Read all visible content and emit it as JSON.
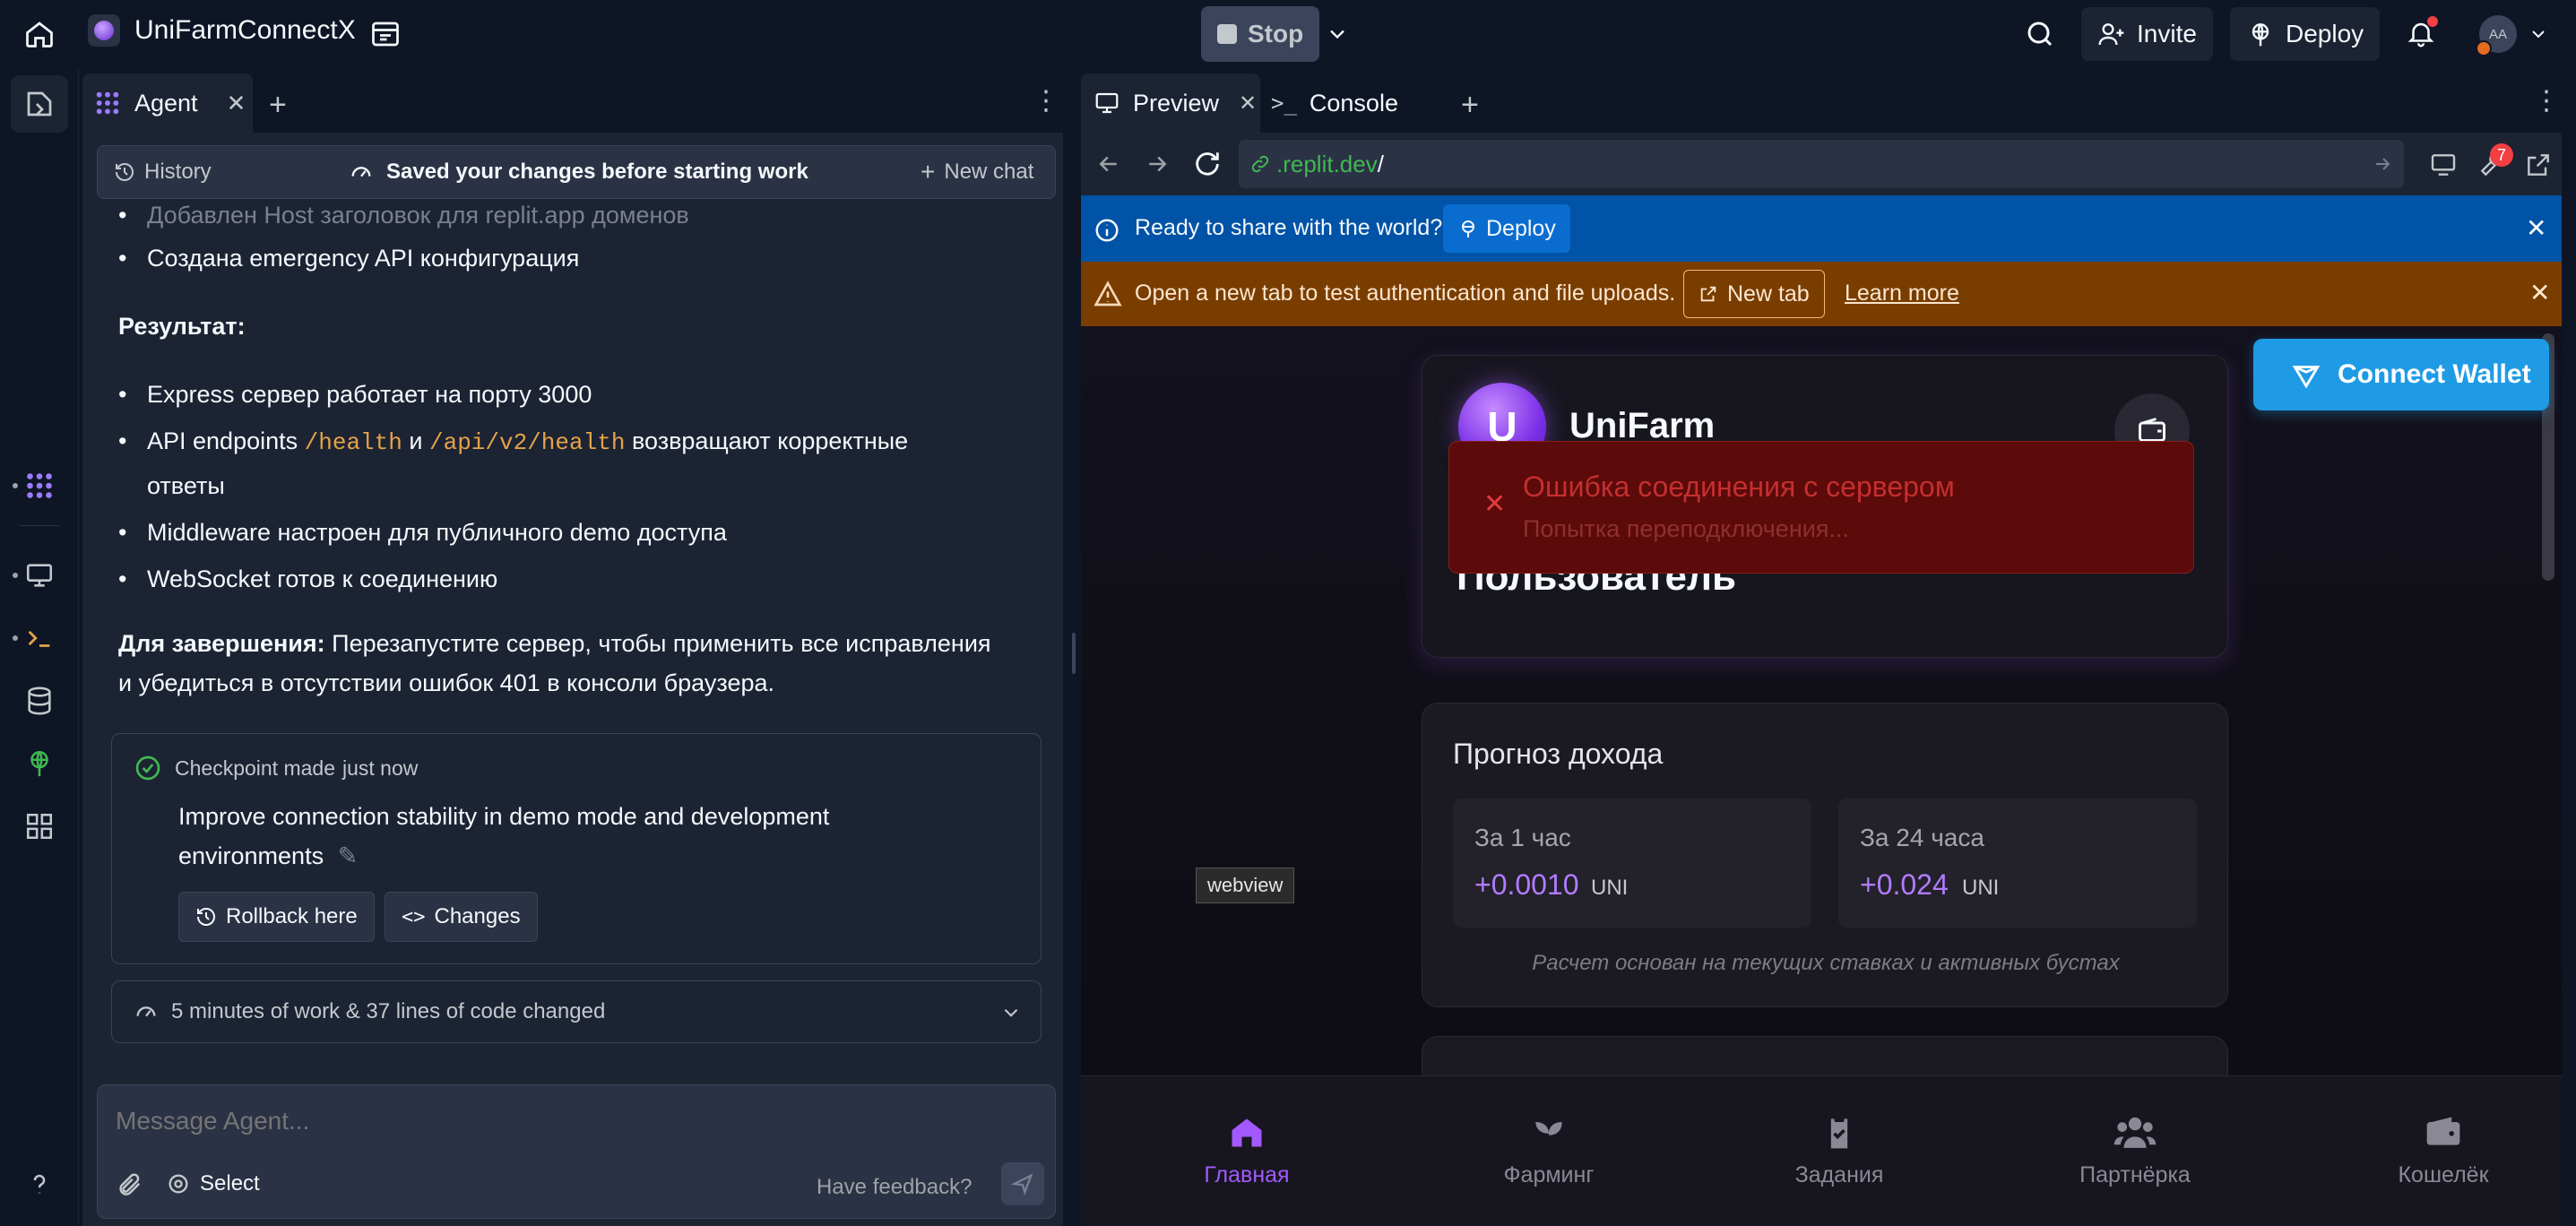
{
  "topbar": {
    "project_name": "UniFarmConnectX",
    "stop_label": "Stop",
    "invite_label": "Invite",
    "deploy_label": "Deploy",
    "avatar_initials": "AA"
  },
  "agent_tab": {
    "label": "Agent",
    "history_label": "History",
    "saved_notice": "Saved your changes before starting work",
    "new_chat_label": "New chat"
  },
  "message": {
    "faded_item": "Добавлен Host заголовок для replit.app доменов",
    "item_emergency": "Создана emergency API конфигурация",
    "result_heading": "Результат:",
    "results": [
      "Express сервер работает на порту 3000",
      "Middleware настроен для публичного demo доступа",
      "WebSocket готов к соединению"
    ],
    "api_prefix": "API endpoints",
    "api_path1": "/health",
    "api_and": "и",
    "api_path2": "/api/v2/health",
    "api_suffix_1": "возвращают корректные",
    "api_suffix_2": "ответы",
    "finish_bold": "Для завершения:",
    "finish_text_1": "Перезапустите сервер, чтобы применить все исправления",
    "finish_text_2": "и убедиться в отсутствии ошибок 401 в консоли браузера."
  },
  "checkpoint": {
    "made_label": "Checkpoint made",
    "when": "just now",
    "description_1": "Improve connection stability in demo mode and development",
    "description_2": "environments",
    "rollback_label": "Rollback here",
    "changes_label": "Changes"
  },
  "work_summary": "5 minutes of work & 37 lines of code changed",
  "composer": {
    "placeholder": "Message Agent...",
    "select_label": "Select",
    "feedback_label": "Have feedback?"
  },
  "preview_tabs": {
    "preview_label": "Preview",
    "console_label": "Console"
  },
  "url_bar": {
    "host": ".replit.dev",
    "path": "/",
    "badge_count": "7"
  },
  "share_banner": {
    "text": "Ready to share with the world?",
    "deploy_label": "Deploy"
  },
  "auth_banner": {
    "text": "Open a new tab to test authentication and file uploads.",
    "new_tab_label": "New tab",
    "learn_more_label": "Learn more"
  },
  "app": {
    "connect_wallet_label": "Connect Wallet",
    "logo_letter": "U",
    "brand_name": "UniFarm",
    "user_label": "Пользователь",
    "error_title": "Ошибка соединения с сервером",
    "error_subtitle": "Попытка переподключения...",
    "forecast_title": "Прогноз дохода",
    "forecast_1h_label": "За 1 час",
    "forecast_1h_value": "+0.0010",
    "forecast_24h_label": "За 24 часа",
    "forecast_24h_value": "+0.024",
    "unit": "UNI",
    "forecast_note": "Расчет основан на текущих ставках и активных бустах",
    "webview_tooltip": "webview",
    "nav": [
      {
        "label": "Главная",
        "icon": "home-icon"
      },
      {
        "label": "Фарминг",
        "icon": "sprout-icon"
      },
      {
        "label": "Задания",
        "icon": "clipboard-check-icon"
      },
      {
        "label": "Партнёрка",
        "icon": "users-icon"
      },
      {
        "label": "Кошелёк",
        "icon": "wallet-icon"
      }
    ]
  },
  "colors": {
    "accent_purple": "#a259ff",
    "deploy_blue": "#0053a6",
    "warning_orange": "#7a3d00",
    "error_red": "#5c0a0a",
    "wallet_blue": "#1f9be6",
    "code_orange": "#e4a348",
    "link_green": "#3fb950"
  }
}
